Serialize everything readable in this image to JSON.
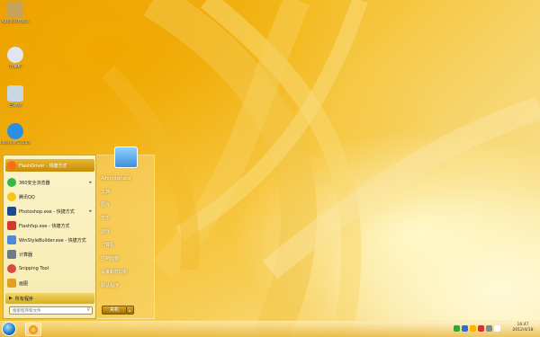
{
  "desktop": {
    "icons": [
      {
        "label": "Administrator",
        "icon": "user-folder-icon",
        "color": "#c9a25a"
      },
      {
        "label": "计算机",
        "icon": "computer-icon",
        "color": "#dfe6ef"
      },
      {
        "label": "回收站",
        "icon": "recycle-bin-icon",
        "color": "#c9d6e4"
      },
      {
        "label": "Internet Explorer",
        "icon": "internet-explorer-icon",
        "color": "#2a8fe0"
      }
    ]
  },
  "start_menu": {
    "pinned": [
      {
        "label": "FlashDriver - 快捷方式",
        "icon": "flashdriver-icon",
        "color": "#ff6a1a",
        "arrow": ""
      },
      {
        "label": "360安全浏览器",
        "icon": "360-browser-icon",
        "color": "#3bb54a",
        "arrow": "▸"
      },
      {
        "label": "腾讯QQ",
        "icon": "qq-icon",
        "color": "#f7c21a",
        "arrow": ""
      },
      {
        "label": "Photoshop.exe - 快捷方式",
        "icon": "photoshop-icon",
        "color": "#1f4b8e",
        "arrow": "▸"
      },
      {
        "label": "Flashfxp.exe - 快捷方式",
        "icon": "flashfxp-icon",
        "color": "#d33a2a",
        "arrow": ""
      },
      {
        "label": "WinStyleBuilder.exe - 快捷方式",
        "icon": "winstylebuilder-icon",
        "color": "#4a8ad8",
        "arrow": ""
      },
      {
        "label": "计算器",
        "icon": "calculator-icon",
        "color": "#6c7a8a",
        "arrow": ""
      },
      {
        "label": "Snipping Tool",
        "icon": "snipping-tool-icon",
        "color": "#d84a3a",
        "arrow": ""
      },
      {
        "label": "画图",
        "icon": "paint-icon",
        "color": "#e0a020",
        "arrow": ""
      }
    ],
    "all_programs": "所有程序",
    "search_placeholder": "搜索程序和文件",
    "right_items": [
      {
        "label": "Administrator"
      },
      {
        "label": "文档"
      },
      {
        "label": "图片"
      },
      {
        "label": "音乐"
      },
      {
        "label": "游戏"
      },
      {
        "label": "计算机"
      },
      {
        "label": "控制面板"
      },
      {
        "label": "设备和打印机"
      },
      {
        "label": "默认程序"
      }
    ],
    "shutdown_label": "关机",
    "shutdown_arrow": "▸"
  },
  "taskbar": {
    "clock_time": "16:47",
    "clock_date": "2012/4/18",
    "tray_colors": [
      "#3aa03a",
      "#2a70c8",
      "#ffb000",
      "#d83030",
      "#888888",
      "#ffffff"
    ]
  }
}
